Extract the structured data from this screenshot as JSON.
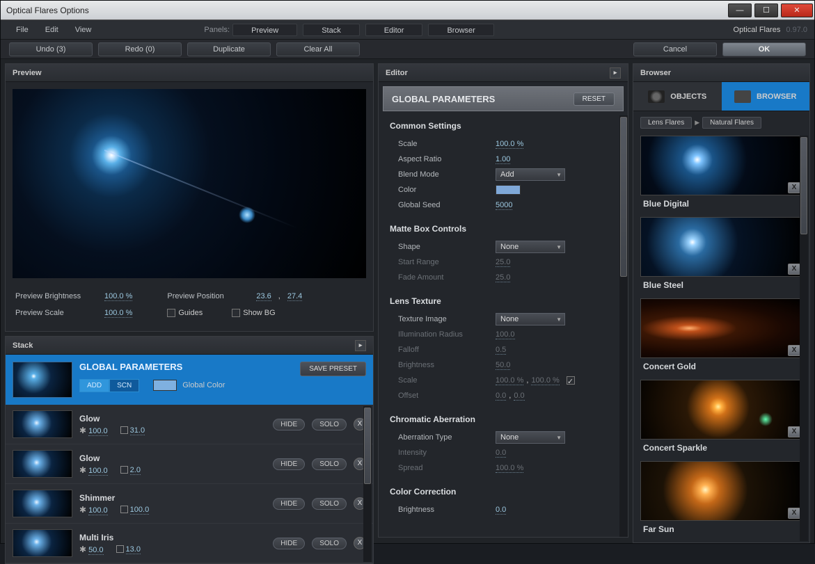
{
  "window": {
    "title": "Optical Flares Options"
  },
  "menu": {
    "file": "File",
    "edit": "Edit",
    "view": "View",
    "panels_label": "Panels:",
    "preview": "Preview",
    "stack": "Stack",
    "editor": "Editor",
    "browser": "Browser"
  },
  "brand": {
    "name": "Optical Flares",
    "version": "0.97.0"
  },
  "toolbar": {
    "undo": "Undo (3)",
    "redo": "Redo (0)",
    "duplicate": "Duplicate",
    "clearall": "Clear All",
    "cancel": "Cancel",
    "ok": "OK"
  },
  "preview": {
    "title": "Preview",
    "brightness_label": "Preview Brightness",
    "brightness_val": "100.0 %",
    "scale_label": "Preview Scale",
    "scale_val": "100.0 %",
    "position_label": "Preview Position",
    "pos_x": "23.6",
    "pos_y": "27.4",
    "guides": "Guides",
    "showbg": "Show BG"
  },
  "stack": {
    "title": "Stack",
    "head": "GLOBAL PARAMETERS",
    "add": "ADD",
    "scn": "SCN",
    "global_color": "Global Color",
    "save": "SAVE PRESET",
    "hide": "HIDE",
    "solo": "SOLO",
    "items": [
      {
        "name": "Glow",
        "v1": "100.0",
        "v2": "31.0"
      },
      {
        "name": "Glow",
        "v1": "100.0",
        "v2": "2.0"
      },
      {
        "name": "Shimmer",
        "v1": "100.0",
        "v2": "100.0"
      },
      {
        "name": "Multi Iris",
        "v1": "50.0",
        "v2": "13.0"
      }
    ]
  },
  "editor": {
    "title": "Editor",
    "head": "GLOBAL PARAMETERS",
    "reset": "RESET",
    "common": {
      "h": "Common Settings",
      "scale": "Scale",
      "scale_v": "100.0 %",
      "aspect": "Aspect Ratio",
      "aspect_v": "1.00",
      "blend": "Blend Mode",
      "blend_v": "Add",
      "color": "Color",
      "seed": "Global Seed",
      "seed_v": "5000"
    },
    "matte": {
      "h": "Matte Box Controls",
      "shape": "Shape",
      "shape_v": "None",
      "start": "Start Range",
      "start_v": "25.0",
      "fade": "Fade Amount",
      "fade_v": "25.0"
    },
    "lens": {
      "h": "Lens Texture",
      "tex": "Texture Image",
      "tex_v": "None",
      "illum": "Illumination Radius",
      "illum_v": "100.0",
      "falloff": "Falloff",
      "falloff_v": "0.5",
      "bright": "Brightness",
      "bright_v": "50.0",
      "scale": "Scale",
      "scale_v1": "100.0 %",
      "scale_v2": "100.0 %",
      "offset": "Offset",
      "off1": "0.0",
      "off2": "0.0"
    },
    "chrom": {
      "h": "Chromatic Aberration",
      "type": "Aberration Type",
      "type_v": "None",
      "intens": "Intensity",
      "intens_v": "0.0",
      "spread": "Spread",
      "spread_v": "100.0 %"
    },
    "cc": {
      "h": "Color Correction",
      "bright": "Brightness",
      "bright_v": "0.0"
    }
  },
  "browser": {
    "title": "Browser",
    "tab_objects": "OBJECTS",
    "tab_browser": "BROWSER",
    "crumb1": "Lens Flares",
    "crumb2": "Natural Flares",
    "items": [
      {
        "name": "Blue Digital"
      },
      {
        "name": "Blue Steel"
      },
      {
        "name": "Concert Gold"
      },
      {
        "name": "Concert Sparkle"
      },
      {
        "name": "Far Sun"
      }
    ]
  }
}
